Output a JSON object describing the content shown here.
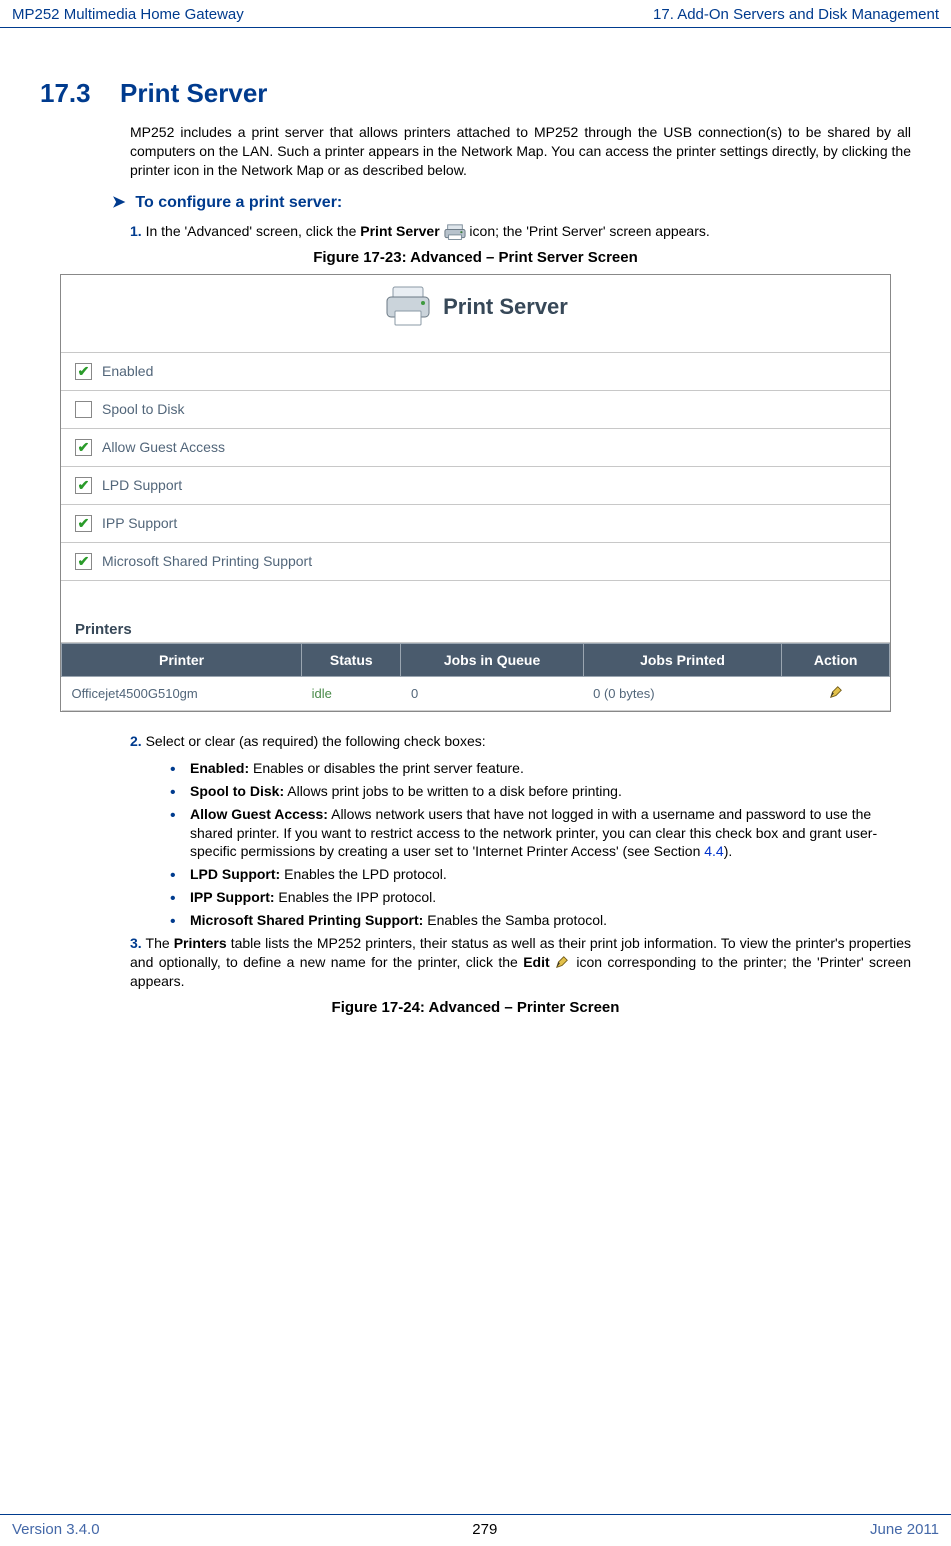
{
  "header": {
    "left": "MP252 Multimedia Home Gateway",
    "right": "17. Add-On Servers and Disk Management"
  },
  "section": {
    "number": "17.3",
    "title": "Print Server"
  },
  "intro": "MP252 includes a print server that allows printers attached to MP252 through the USB connection(s) to be shared by all computers on the LAN. Such a printer appears in the Network Map. You can access the printer settings directly, by clicking the printer icon in the Network Map or as described below.",
  "config_heading": "To configure a print server:",
  "step1": {
    "num": "1.",
    "before": "In the 'Advanced' screen, click the ",
    "bold": "Print Server",
    "after": " icon; the 'Print Server' screen appears."
  },
  "figure23": "Figure 17-23: Advanced – Print Server Screen",
  "print_server_panel": {
    "title": "Print Server",
    "options": [
      {
        "label": "Enabled",
        "checked": true
      },
      {
        "label": "Spool to Disk",
        "checked": false
      },
      {
        "label": "Allow Guest Access",
        "checked": true
      },
      {
        "label": "LPD Support",
        "checked": true
      },
      {
        "label": "IPP Support",
        "checked": true
      },
      {
        "label": "Microsoft Shared Printing Support",
        "checked": true
      }
    ],
    "printers_label": "Printers",
    "table": {
      "headers": [
        "Printer",
        "Status",
        "Jobs in Queue",
        "Jobs Printed",
        "Action"
      ],
      "row": {
        "printer": "Officejet4500G510gm",
        "status": "idle",
        "jobs_in_queue": "0",
        "jobs_printed": "0 (0 bytes)"
      }
    }
  },
  "step2": {
    "num": "2.",
    "text": "Select or clear (as required) the following check boxes:",
    "bullets": [
      {
        "b": "Enabled:",
        "t": " Enables or disables the print server feature."
      },
      {
        "b": "Spool to Disk:",
        "t": " Allows print jobs to be written to a disk before printing."
      },
      {
        "b": "Allow Guest Access:",
        "t": " Allows network users that have not logged in with a username and password to use the shared printer. If you want to restrict access to the network printer, you can clear this check box and grant user-specific permissions by creating a user set to 'Internet Printer Access' (see Section ",
        "link": "4.4",
        "tail": ")."
      },
      {
        "b": "LPD Support:",
        "t": " Enables the LPD protocol."
      },
      {
        "b": "IPP Support:",
        "t": " Enables the IPP protocol."
      },
      {
        "b": "Microsoft Shared Printing Support:",
        "t": " Enables the Samba protocol."
      }
    ]
  },
  "step3": {
    "num": "3.",
    "before": "The ",
    "bold1": "Printers",
    "mid": " table lists the MP252 printers, their status as well as their print job information. To view the printer's properties and optionally, to define a new name for the printer, click the ",
    "bold2": "Edit",
    "after": " icon corresponding to the printer; the 'Printer' screen appears."
  },
  "figure24": "Figure 17-24: Advanced – Printer Screen",
  "footer": {
    "left": "Version 3.4.0",
    "center": "279",
    "right": "June 2011"
  }
}
